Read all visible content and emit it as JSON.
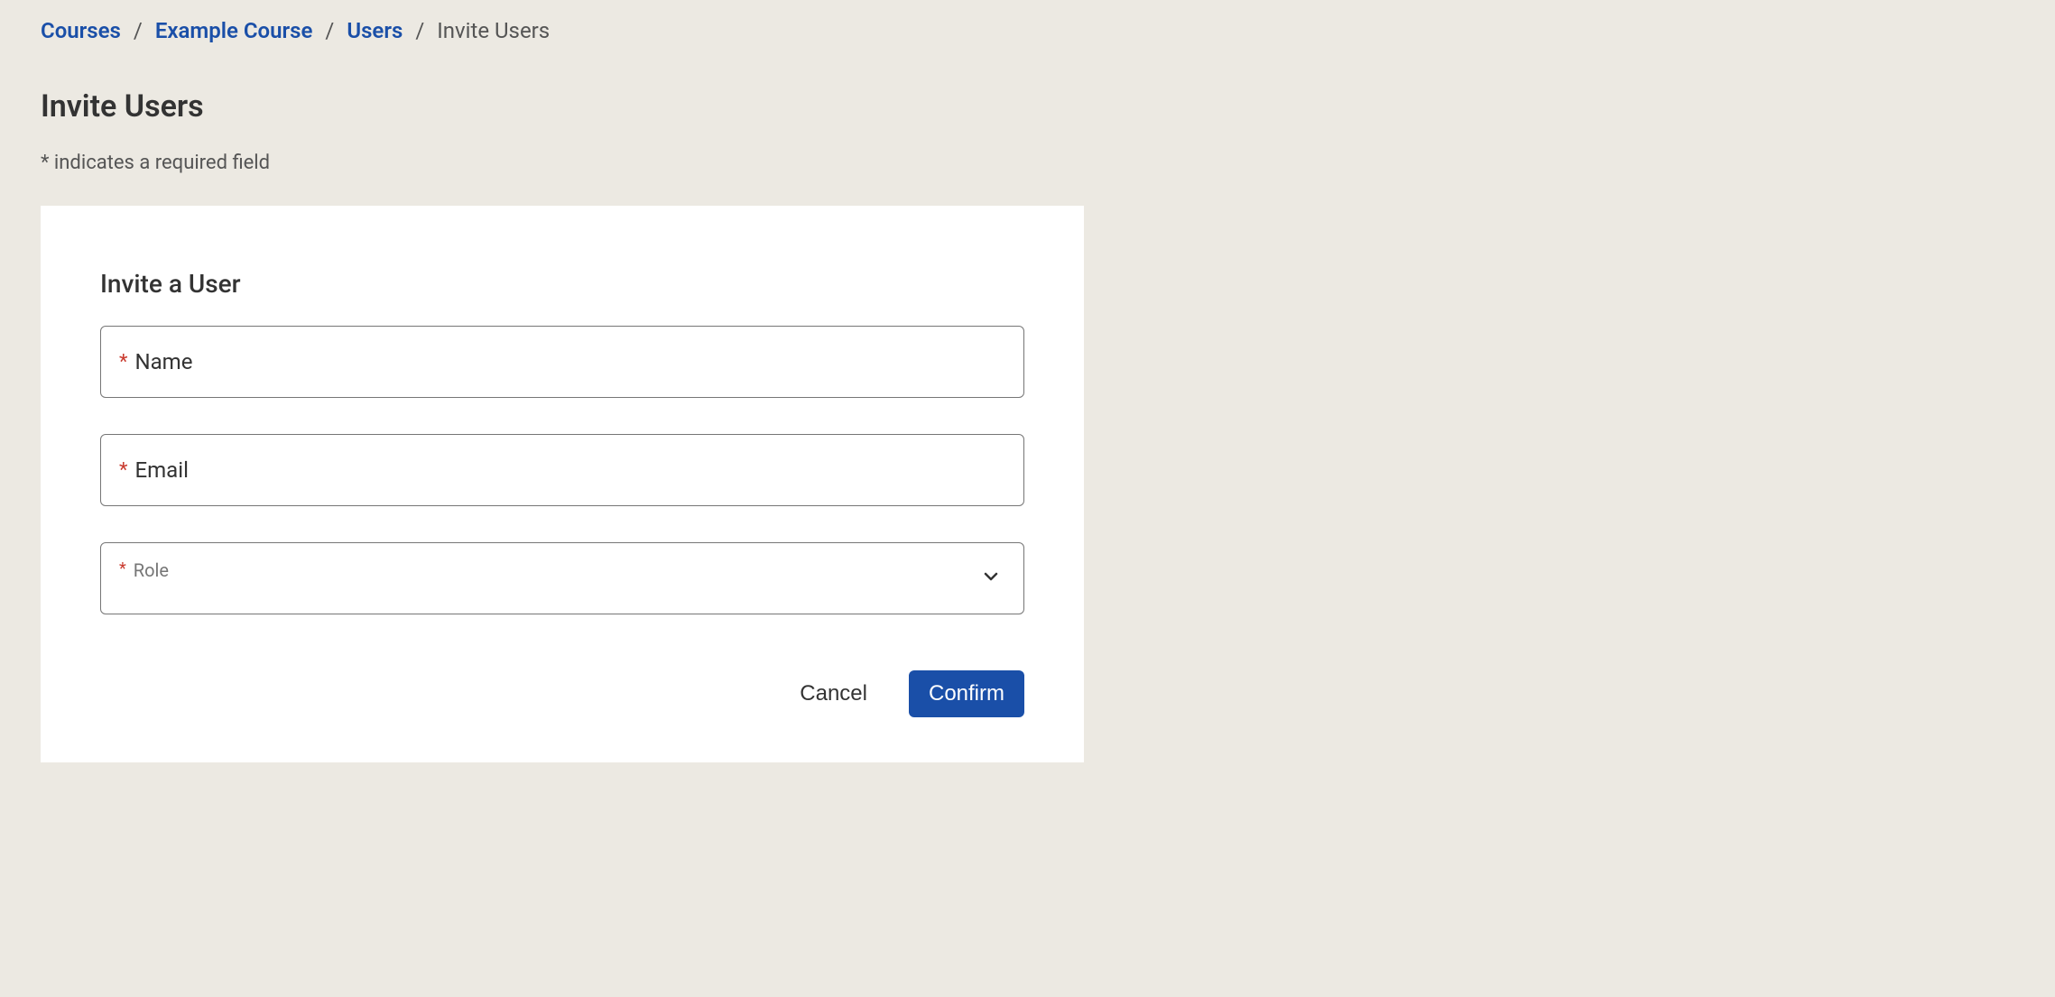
{
  "breadcrumb": {
    "items": [
      {
        "label": "Courses"
      },
      {
        "label": "Example Course"
      },
      {
        "label": "Users"
      }
    ],
    "current": "Invite Users",
    "separator": "/"
  },
  "page": {
    "title": "Invite Users",
    "required_note": "* indicates a required field"
  },
  "form": {
    "title": "Invite a User",
    "asterisk": "*",
    "fields": {
      "name": {
        "label": "Name",
        "value": ""
      },
      "email": {
        "label": "Email",
        "value": ""
      },
      "role": {
        "label": "Role",
        "selected": ""
      }
    },
    "actions": {
      "cancel": "Cancel",
      "confirm": "Confirm"
    }
  }
}
